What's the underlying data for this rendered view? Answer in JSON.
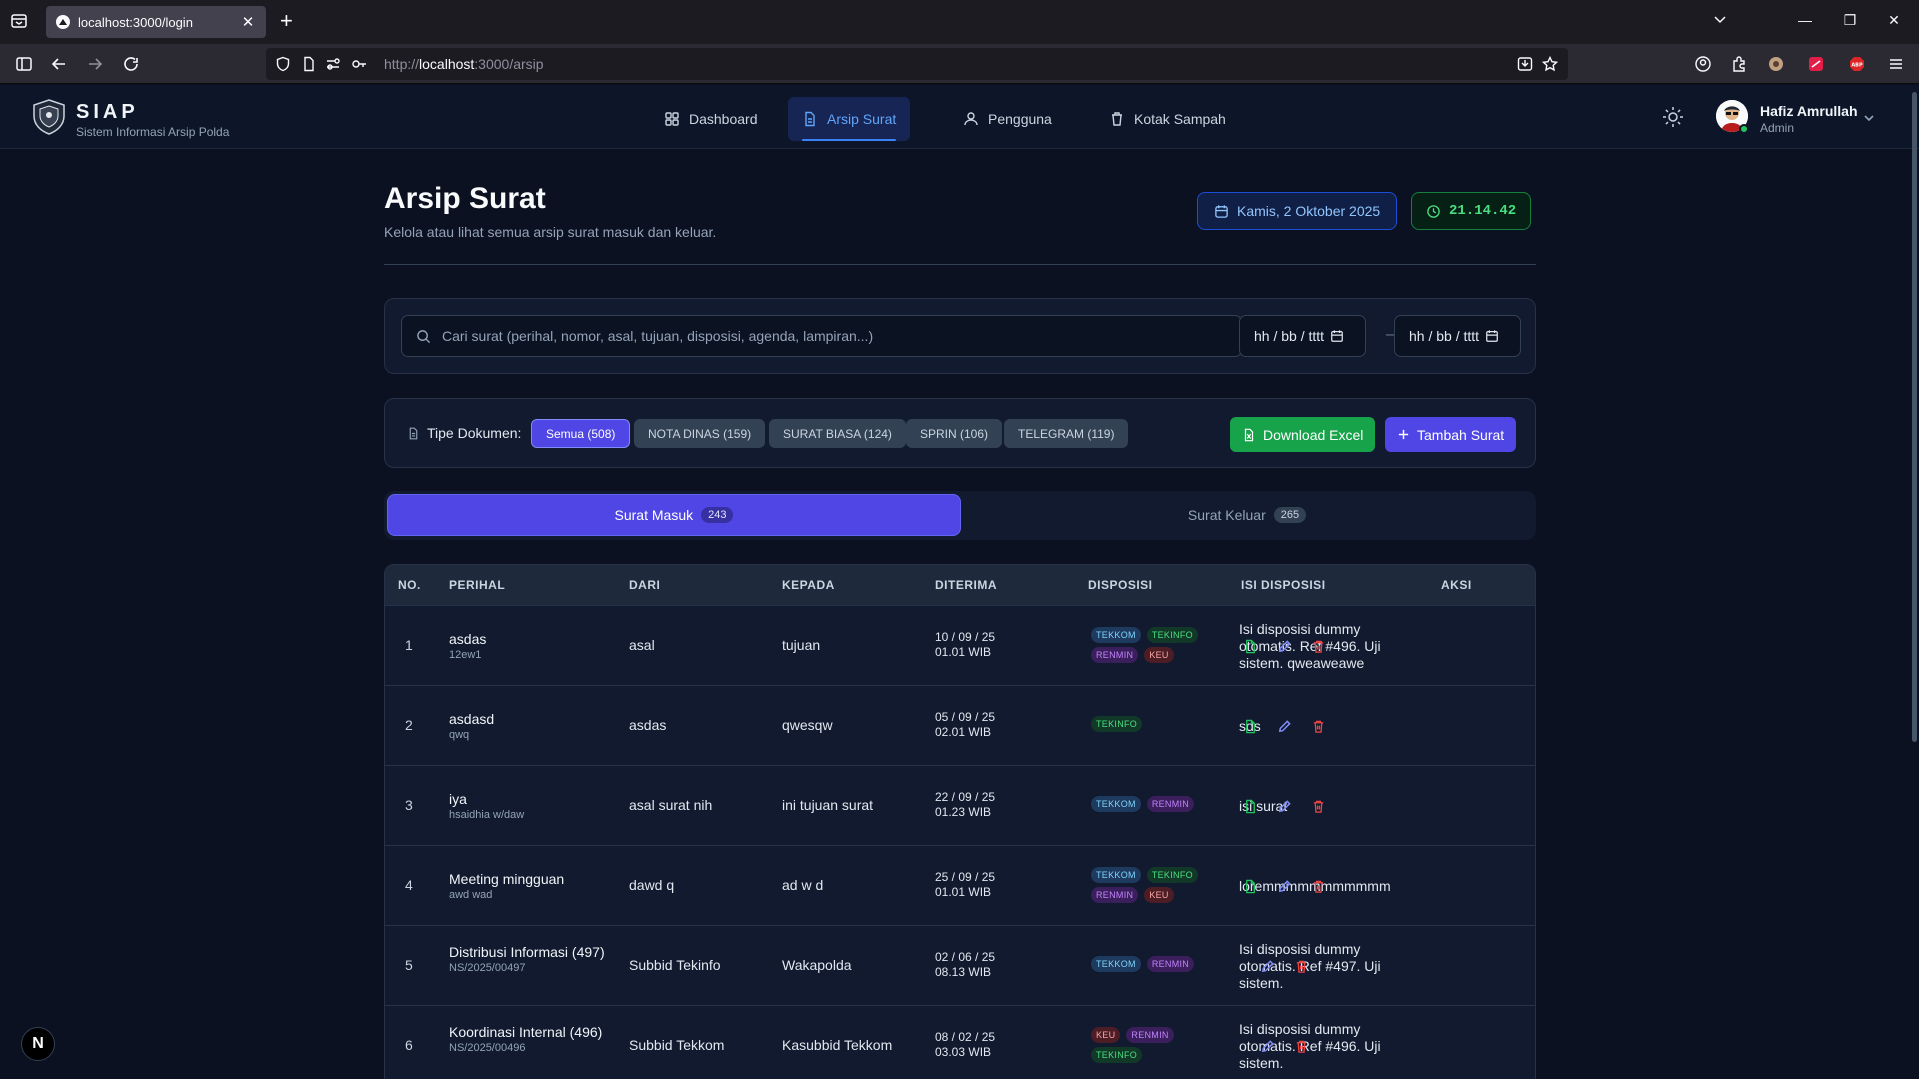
{
  "browser": {
    "tab_title": "localhost:3000/login",
    "url_prefix": "http://",
    "url_host": "localhost",
    "url_path": ":3000/arsip"
  },
  "app": {
    "brand": "SIAP",
    "brand_sub": "Sistem Informasi Arsip Polda",
    "nav": {
      "dashboard": "Dashboard",
      "arsip": "Arsip Surat",
      "pengguna": "Pengguna",
      "sampah": "Kotak Sampah"
    },
    "user": {
      "name": "Hafiz Amrullah",
      "role": "Admin"
    }
  },
  "page": {
    "title": "Arsip Surat",
    "subtitle": "Kelola atau lihat semua arsip surat masuk dan keluar.",
    "date": "Kamis, 2 Oktober 2025",
    "time": "21.14.42"
  },
  "search": {
    "placeholder": "Cari surat (perihal, nomor, asal, tujuan, disposisi, agenda, lampiran...)",
    "date_from": "hh / bb / tttt",
    "date_to": "hh / bb / tttt",
    "separator": "—"
  },
  "filter": {
    "label": "Tipe Dokumen:",
    "chips": [
      "Semua (508)",
      "NOTA DINAS (159)",
      "SURAT BIASA (124)",
      "SPRIN (106)",
      "TELEGRAM (119)"
    ],
    "download": "Download Excel",
    "add": "Tambah Surat"
  },
  "tabs": {
    "masuk": {
      "label": "Surat Masuk",
      "count": "243"
    },
    "keluar": {
      "label": "Surat Keluar",
      "count": "265"
    }
  },
  "table": {
    "headers": [
      "NO.",
      "PERIHAL",
      "DARI",
      "KEPADA",
      "DITERIMA",
      "DISPOSISI",
      "ISI DISPOSISI",
      "AKSI"
    ],
    "rows": [
      {
        "no": "1",
        "perihal": "asdas",
        "nomor": "12ew1",
        "dari": "asal",
        "kepada": "tujuan",
        "tanggal": "10 / 09 / 25",
        "jam": "01.01 WIB",
        "disposisi": [
          "TEKKOM",
          "TEKINFO",
          "RENMIN",
          "KEU"
        ],
        "isi": "Isi disposisi dummy otomatis. Ref #496. Uji sistem. qweaweawe",
        "has_view": true
      },
      {
        "no": "2",
        "perihal": "asdasd",
        "nomor": "qwq",
        "dari": "asdas",
        "kepada": "qwesqw",
        "tanggal": "05 / 09 / 25",
        "jam": "02.01 WIB",
        "disposisi": [
          "TEKINFO"
        ],
        "isi": "sds",
        "has_view": true
      },
      {
        "no": "3",
        "perihal": "iya",
        "nomor": "hsaidhia w/daw",
        "dari": "asal surat nih",
        "kepada": "ini tujuan surat",
        "tanggal": "22 / 09 / 25",
        "jam": "01.23 WIB",
        "disposisi": [
          "TEKKOM",
          "RENMIN"
        ],
        "isi": "isi surat",
        "has_view": true
      },
      {
        "no": "4",
        "perihal": "Meeting mingguan",
        "nomor": "awd wad",
        "dari": "dawd q",
        "kepada": "ad w d",
        "tanggal": "25 / 09 / 25",
        "jam": "01.01 WIB",
        "disposisi": [
          "TEKKOM",
          "TEKINFO",
          "RENMIN",
          "KEU"
        ],
        "isi": "loremmmmmmmmmmm",
        "has_view": true
      },
      {
        "no": "5",
        "perihal": "Distribusi Informasi (497)",
        "nomor": "NS/2025/00497",
        "dari": "Subbid Tekinfo",
        "kepada": "Wakapolda",
        "tanggal": "02 / 06 / 25",
        "jam": "08.13 WIB",
        "disposisi": [
          "TEKKOM",
          "RENMIN"
        ],
        "isi": "Isi disposisi dummy otomatis. Ref #497. Uji sistem.",
        "has_view": false
      },
      {
        "no": "6",
        "perihal": "Koordinasi Internal (496)",
        "nomor": "NS/2025/00496",
        "dari": "Subbid Tekkom",
        "kepada": "Kasubbid Tekkom",
        "tanggal": "08 / 02 / 25",
        "jam": "03.03 WIB",
        "disposisi": [
          "KEU",
          "RENMIN",
          "TEKINFO"
        ],
        "isi": "Isi disposisi dummy otomatis. Ref #496. Uji sistem.",
        "has_view": false
      }
    ]
  },
  "colors": {
    "accent": "#4f46e5",
    "success": "#16a34a",
    "danger": "#ef4444",
    "background": "#0b1120"
  },
  "dev_badge": "N"
}
